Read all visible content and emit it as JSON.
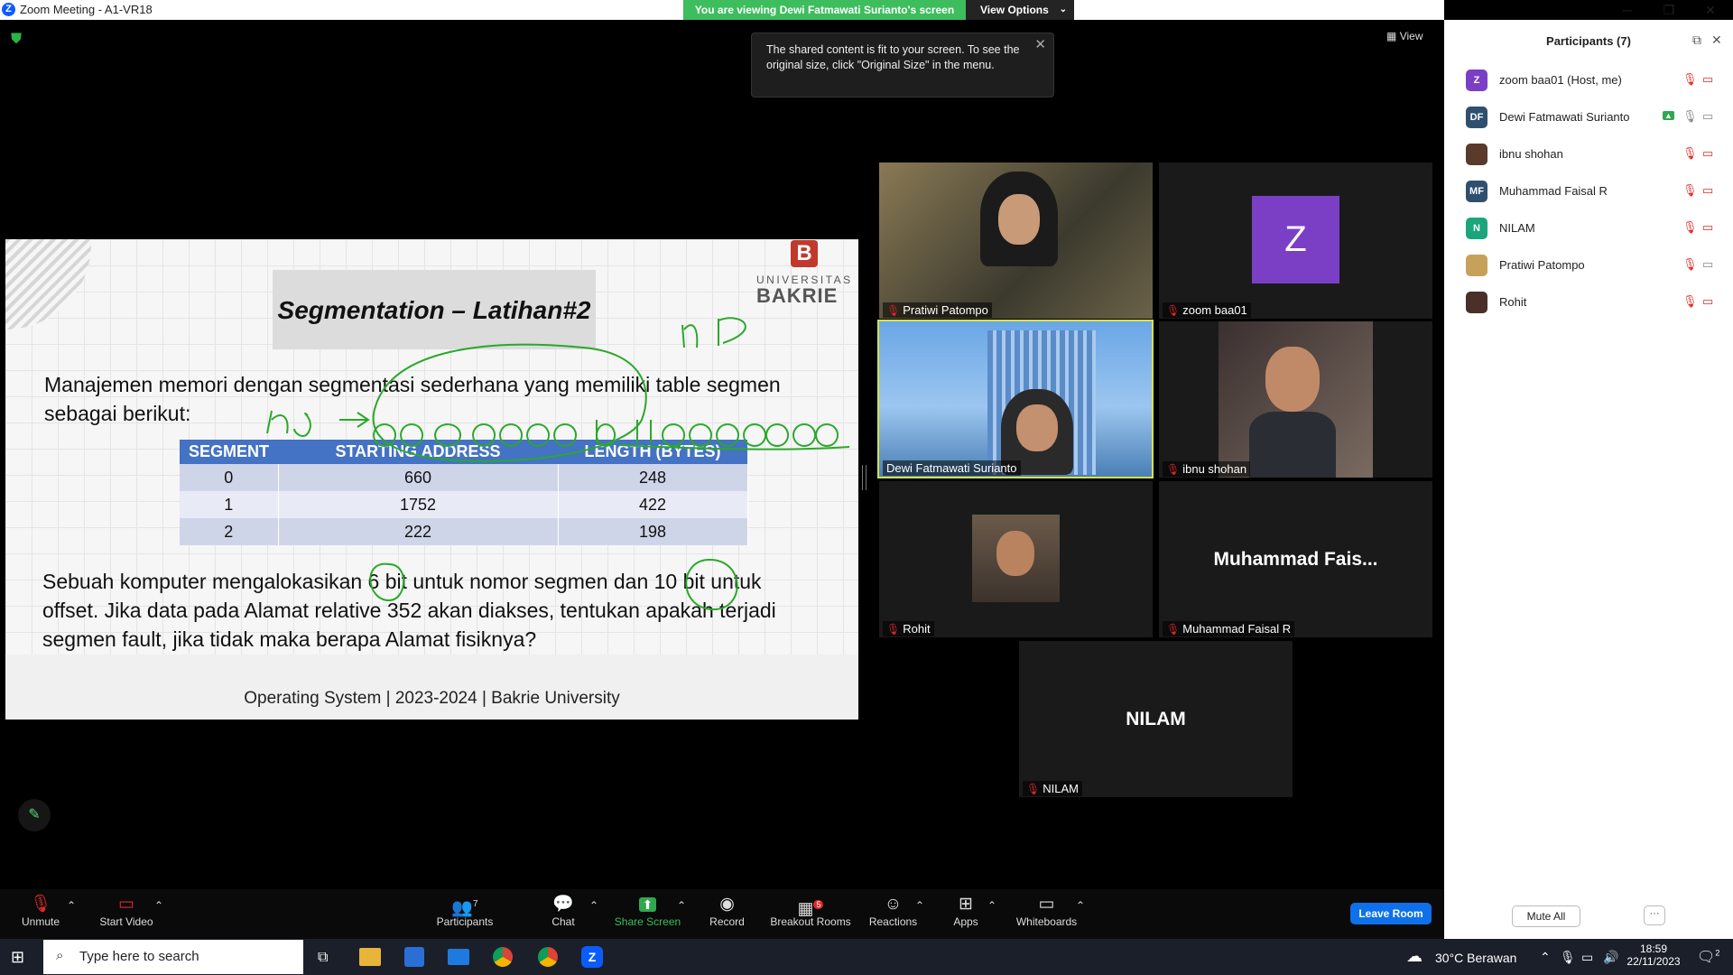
{
  "window": {
    "title": "Zoom Meeting - A1-VR18",
    "minimize": "─",
    "restore": "❐",
    "close": "✕"
  },
  "banner": {
    "text": "You are viewing Dewi Fatmawati Surianto's screen",
    "view_options": "View Options",
    "view_options_caret": "⌄"
  },
  "tooltip": {
    "text": "The shared content is fit to your screen. To see the original size, click \"Original Size\" in the menu.",
    "close": "✕"
  },
  "view_button": "View",
  "slide": {
    "title": "Segmentation – Latihan#2",
    "logo_letter": "B",
    "logo_line1": "UNIVERSITAS",
    "logo_line2": "BAKRIE",
    "paragraph1_line1": "Manajemen memori dengan segmentasi sederhana yang memiliki table segmen",
    "paragraph1_line2": "sebagai berikut:",
    "table": {
      "headers": [
        "SEGMENT",
        "STARTING ADDRESS",
        "LENGTH (BYTES)"
      ],
      "rows": [
        [
          "0",
          "660",
          "248"
        ],
        [
          "1",
          "1752",
          "422"
        ],
        [
          "2",
          "222",
          "198"
        ]
      ]
    },
    "paragraph2_line1": "Sebuah komputer mengalokasikan 6  bit untuk nomor segmen dan 10 bit untuk",
    "paragraph2_line2": "offset. Jika data pada Alamat relative 352 akan diakses, tentukan apakah terjadi",
    "paragraph2_line3": "segmen fault, jika tidak maka berapa Alamat fisiknya?",
    "footer": "Operating System | 2023-2024 | Bakrie University",
    "annotation_color": "#2aa82a"
  },
  "tiles": [
    {
      "name": "Pratiwi Patompo"
    },
    {
      "name": "zoom baa01",
      "avatar_letter": "Z",
      "avatar_color": "#7b3fc6"
    },
    {
      "name": "Dewi Fatmawati Surianto",
      "active_speaker": true,
      "highlight_color": "#d8e04a"
    },
    {
      "name": "ibnu shohan"
    },
    {
      "name": "Rohit"
    },
    {
      "name": "Muhammad Faisal R",
      "big_label": "Muhammad  Fais..."
    },
    {
      "name": "NILAM",
      "big_label": "NILAM"
    }
  ],
  "participants": {
    "title": "Participants (7)",
    "popout_icon": "⧉",
    "close_icon": "✕",
    "list": [
      {
        "avatar": "Z",
        "color": "#7b3fc6",
        "name": "zoom baa01 (Host, me)"
      },
      {
        "avatar": "DF",
        "color": "#2f4f6f",
        "name": "Dewi Fatmawati Surianto"
      },
      {
        "avatar": "",
        "color": "#5a3a2a",
        "name": "ibnu shohan"
      },
      {
        "avatar": "MF",
        "color": "#2f4f6f",
        "name": "Muhammad Faisal R"
      },
      {
        "avatar": "N",
        "color": "#1aa57a",
        "name": "NILAM"
      },
      {
        "avatar": "",
        "color": "#c7a15a",
        "name": "Pratiwi Patompo"
      },
      {
        "avatar": "",
        "color": "#4a3028",
        "name": "Rohit"
      }
    ],
    "mute_all": "Mute All",
    "more": "···"
  },
  "toolbar": {
    "unmute": "Unmute",
    "start_video": "Start Video",
    "participants": "Participants",
    "participants_count": "7",
    "chat": "Chat",
    "share_screen": "Share Screen",
    "record": "Record",
    "breakout_rooms": "Breakout Rooms",
    "breakout_badge": "5",
    "reactions": "Reactions",
    "apps": "Apps",
    "whiteboards": "Whiteboards",
    "leave": "Leave Room",
    "caret": "⌃"
  },
  "taskbar": {
    "search_placeholder": "Type here to search",
    "weather": "30°C  Berawan",
    "time": "18:59",
    "date": "22/11/2023",
    "notification_count": "2"
  }
}
